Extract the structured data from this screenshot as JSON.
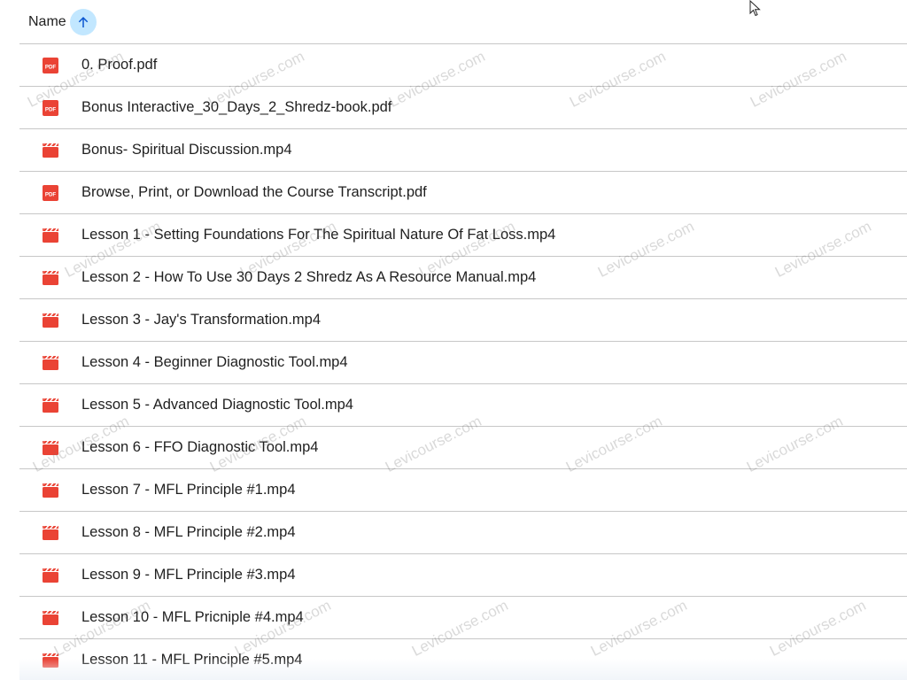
{
  "header": {
    "column_label": "Name",
    "sort_icon": "arrow-up-icon",
    "sort_color": "#c2e7ff"
  },
  "files": [
    {
      "name": "0. Proof.pdf",
      "type": "pdf",
      "icon": "pdf-icon"
    },
    {
      "name": "Bonus Interactive_30_Days_2_Shredz-book.pdf",
      "type": "pdf",
      "icon": "pdf-icon"
    },
    {
      "name": "Bonus- Spiritual Discussion.mp4",
      "type": "video",
      "icon": "video-icon"
    },
    {
      "name": "Browse, Print, or Download the Course Transcript.pdf",
      "type": "pdf",
      "icon": "pdf-icon"
    },
    {
      "name": "Lesson 1 - Setting Foundations For The Spiritual Nature Of Fat Loss.mp4",
      "type": "video",
      "icon": "video-icon"
    },
    {
      "name": "Lesson 2 - How To Use 30 Days 2 Shredz As A Resource Manual.mp4",
      "type": "video",
      "icon": "video-icon"
    },
    {
      "name": "Lesson 3 - Jay's Transformation.mp4",
      "type": "video",
      "icon": "video-icon"
    },
    {
      "name": "Lesson 4 - Beginner Diagnostic Tool.mp4",
      "type": "video",
      "icon": "video-icon"
    },
    {
      "name": "Lesson 5 - Advanced Diagnostic Tool.mp4",
      "type": "video",
      "icon": "video-icon"
    },
    {
      "name": "Lesson 6 - FFO Diagnostic Tool.mp4",
      "type": "video",
      "icon": "video-icon"
    },
    {
      "name": "Lesson 7 - MFL Principle #1.mp4",
      "type": "video",
      "icon": "video-icon"
    },
    {
      "name": "Lesson 8 - MFL Principle #2.mp4",
      "type": "video",
      "icon": "video-icon"
    },
    {
      "name": "Lesson 9 - MFL Principle #3.mp4",
      "type": "video",
      "icon": "video-icon"
    },
    {
      "name": "Lesson 10 - MFL Pricniple #4.mp4",
      "type": "video",
      "icon": "video-icon"
    },
    {
      "name": "Lesson 11 - MFL Principle #5.mp4",
      "type": "video",
      "icon": "video-icon"
    }
  ],
  "colors": {
    "file_icon_red": "#ea4335",
    "divider": "#c7c7c7",
    "text": "#1f1f1f"
  },
  "watermark_text": "Levicourse.com"
}
